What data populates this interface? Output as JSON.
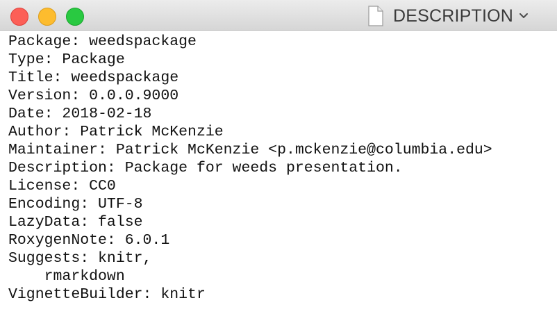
{
  "window": {
    "title": "DESCRIPTION",
    "controls": {
      "close_icon": "close-traffic-light",
      "minimize_icon": "minimize-traffic-light",
      "zoom_icon": "zoom-traffic-light"
    },
    "title_icon": "document-icon",
    "title_menu_icon": "chevron-down-icon",
    "colors": {
      "close": "#fc5f57",
      "minimize": "#fdbc2e",
      "zoom": "#29c941",
      "titlebar": "#e3e3e3",
      "text": "#111111"
    }
  },
  "document": {
    "lines": [
      "Package: weedspackage",
      "Type: Package",
      "Title: weedspackage",
      "Version: 0.0.0.9000",
      "Date: 2018-02-18",
      "Author: Patrick McKenzie",
      "Maintainer: Patrick McKenzie <p.mckenzie@columbia.edu>",
      "Description: Package for weeds presentation.",
      "License: CC0",
      "Encoding: UTF-8",
      "LazyData: false",
      "RoxygenNote: 6.0.1",
      "Suggests: knitr,",
      "    rmarkdown",
      "VignetteBuilder: knitr"
    ]
  }
}
